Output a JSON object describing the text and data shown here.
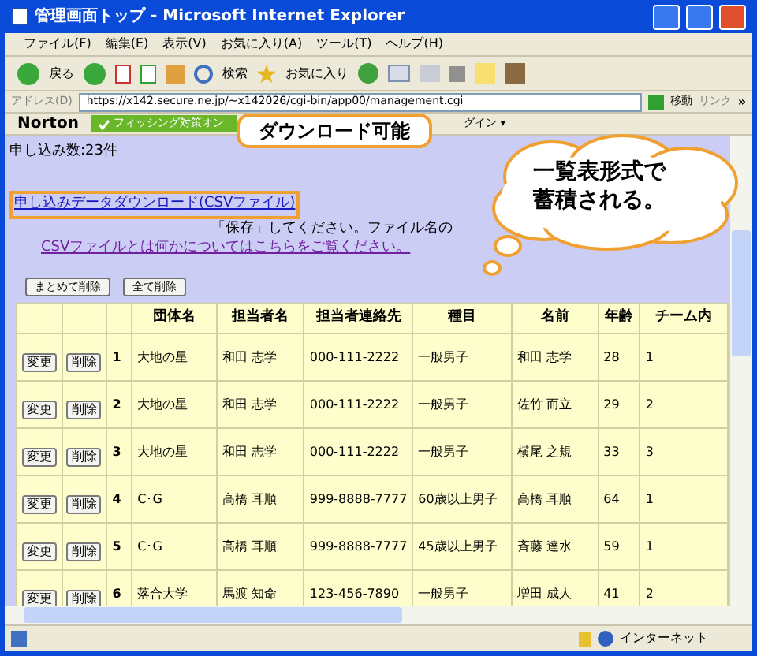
{
  "window": {
    "title": "管理画面トップ - Microsoft Internet Explorer"
  },
  "menu": [
    "ファイル(F)",
    "編集(E)",
    "表示(V)",
    "お気に入り(A)",
    "ツール(T)",
    "ヘルプ(H)"
  ],
  "toolbar": {
    "back": "戻る",
    "search": "検索",
    "favorites": "お気に入り"
  },
  "address": {
    "label": "アドレス(D)",
    "value": "https://x142.secure.ne.jp/~x142026/cgi-bin/app00/management.cgi",
    "go": "移動",
    "links": "リンク",
    "more": "»"
  },
  "norton": {
    "brand": "Norton",
    "phishing": "フィッシング対策オン",
    "login": "グイン ▾"
  },
  "content": {
    "count": "申し込み数:23件",
    "download_link": "申し込みデータダウンロード(CSVファイル)",
    "note": "「保存」してください。ファイル名の",
    "help_link": "CSVファイルとは何かについてはこちらをご覧ください。",
    "buttons": [
      "まとめて削除",
      "全て削除"
    ]
  },
  "table": {
    "columns": [
      "",
      "",
      "",
      "団体名",
      "担当者名",
      "担当者連絡先",
      "種目",
      "名前",
      "年齢",
      "チーム内"
    ],
    "rows": [
      [
        "変更",
        "削除",
        "1",
        "大地の星",
        "和田 志学",
        "000-111-2222",
        "一般男子",
        "和田 志学",
        "28",
        "1"
      ],
      [
        "変更",
        "削除",
        "2",
        "大地の星",
        "和田 志学",
        "000-111-2222",
        "一般男子",
        "佐竹 而立",
        "29",
        "2"
      ],
      [
        "変更",
        "削除",
        "3",
        "大地の星",
        "和田 志学",
        "000-111-2222",
        "一般男子",
        "横尾 之規",
        "33",
        "3"
      ],
      [
        "変更",
        "削除",
        "4",
        "C･G",
        "高橋 耳順",
        "999-8888-7777",
        "60歳以上男子",
        "高橋 耳順",
        "64",
        "1"
      ],
      [
        "変更",
        "削除",
        "5",
        "C･G",
        "高橋 耳順",
        "999-8888-7777",
        "45歳以上男子",
        "斉藤 達水",
        "59",
        "1"
      ],
      [
        "変更",
        "削除",
        "6",
        "落合大学",
        "馬渡 知命",
        "123-456-7890",
        "一般男子",
        "増田 成人",
        "41",
        "2"
      ]
    ]
  },
  "callouts": [
    {
      "kind": "speech",
      "lines": [
        "ダウンロード可能"
      ]
    },
    {
      "kind": "cloud",
      "lines": [
        "一覧表形式で",
        "蓄積される。"
      ]
    }
  ],
  "status_bar": {
    "zone": "インターネット"
  }
}
